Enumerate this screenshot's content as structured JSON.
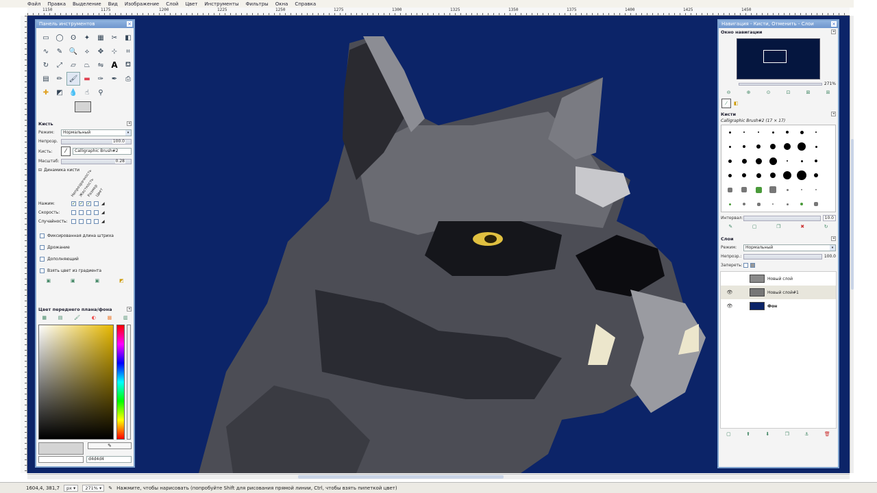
{
  "menu": [
    "Файл",
    "Правка",
    "Выделение",
    "Вид",
    "Изображение",
    "Слой",
    "Цвет",
    "Инструменты",
    "Фильтры",
    "Окна",
    "Справка"
  ],
  "ruler_ticks": [
    "1150",
    "1175",
    "1200",
    "1225",
    "1250",
    "1275",
    "1300",
    "1325",
    "1350",
    "1375",
    "1400",
    "1425",
    "1450"
  ],
  "toolbox": {
    "title": "Панель инструментов",
    "brush_section": "Кисть",
    "mode_label": "Режим:",
    "mode_value": "Нормальный",
    "opacity_label": "Непрозр.",
    "opacity_value": "100.0",
    "brush_label": "Кисть:",
    "brush_value": "Calligraphic Brush#2",
    "scale_label": "Масштаб:",
    "scale_value": "0.28",
    "dynamics_label": "Динамика кисти",
    "dyn_headers": [
      "Непрозрачность",
      "Жесткость",
      "Размер",
      "Цвет"
    ],
    "dyn_rows": [
      {
        "label": "Нажим:",
        "checks": [
          true,
          true,
          true,
          false
        ]
      },
      {
        "label": "Скорость:",
        "checks": [
          false,
          false,
          false,
          false
        ]
      },
      {
        "label": "Случайность:",
        "checks": [
          false,
          false,
          false,
          false
        ]
      }
    ],
    "options": [
      "Фиксированная длина штриха",
      "Дрожание",
      "Дополняющий",
      "Взять цвет из градиента"
    ],
    "fgbg_title": "Цвет переднего плана/фона",
    "hex_value": "d4d4d4"
  },
  "right_dock": {
    "title": "Навигация - Кисти, Отменить - Слои",
    "nav_title": "Окно навигации",
    "zoom_value": "271%",
    "brushes_title": "Кисти",
    "brush_name": "Calligraphic Brush#2 (17 × 17)",
    "spacing_label": "Интервал:",
    "spacing_value": "10.0",
    "layers_title": "Слои",
    "layers_mode_label": "Режим:",
    "layers_mode_value": "Нормальный",
    "layers_opacity_label": "Непрозр.:",
    "layers_opacity_value": "100.0",
    "lock_label": "Запереть:",
    "layers": [
      {
        "name": "Новый слой",
        "visible": false,
        "color": "#8a8a8a"
      },
      {
        "name": "Новый слой#1",
        "visible": true,
        "color": "#777777"
      },
      {
        "name": "Фон",
        "visible": true,
        "color": "#0c2468"
      }
    ]
  },
  "status": {
    "coords": "1604,4, 381,7",
    "unit": "px",
    "zoom": "271%",
    "message": "Нажмите, чтобы нарисовать (попробуйте Shift для рисования прямой линии, Ctrl, чтобы взять пипеткой цвет)"
  },
  "colors": {
    "canvas_bg": "#0c2468",
    "eye": "#e0c040",
    "fang": "#ece6cc"
  }
}
